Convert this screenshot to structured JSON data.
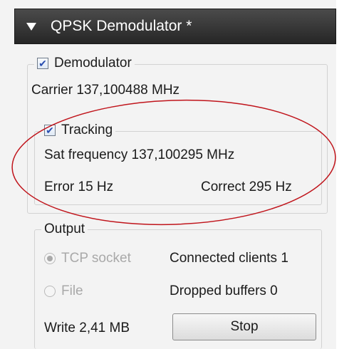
{
  "header": {
    "title": "QPSK Demodulator *"
  },
  "demodulator": {
    "label": "Demodulator",
    "checked": true,
    "carrier_text": "Carrier 137,100488 MHz"
  },
  "tracking": {
    "label": "Tracking",
    "checked": true,
    "sat_frequency_text": "Sat frequency 137,100295 MHz",
    "error_text": "Error 15 Hz",
    "correct_text": "Correct 295 Hz"
  },
  "output": {
    "label": "Output",
    "tcp_label": "TCP socket",
    "tcp_selected": true,
    "file_label": "File",
    "file_selected": false,
    "connected_clients_text": "Connected clients 1",
    "dropped_buffers_text": "Dropped buffers 0",
    "write_text": "Write 2,41 MB",
    "stop_label": "Stop"
  },
  "colors": {
    "annotation_ellipse": "#c0141b",
    "header_bg": "#2e2e2e",
    "checkbox_mark": "#2b4fb0"
  }
}
